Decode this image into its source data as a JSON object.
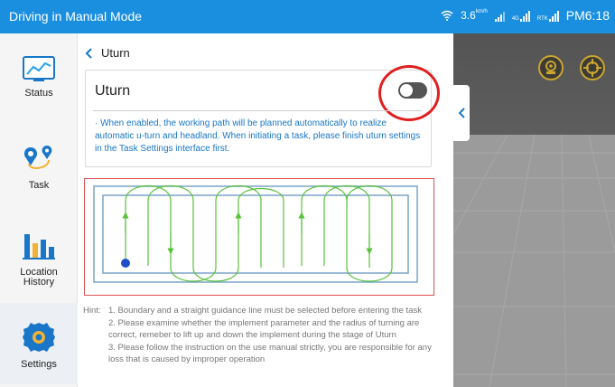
{
  "status_bar": {
    "title": "Driving in Manual Mode",
    "speed_value": "3.6",
    "speed_unit": "km/h",
    "network_label": "4G",
    "rtk_label": "RTK",
    "time": "PM6:18"
  },
  "sidebar": {
    "items": [
      {
        "label": "Status",
        "icon": "status-chart-icon"
      },
      {
        "label": "Task",
        "icon": "route-icon"
      },
      {
        "label": "Location History",
        "icon": "bar-chart-icon"
      },
      {
        "label": "Settings",
        "icon": "gear-icon"
      }
    ],
    "active": "Settings"
  },
  "panel": {
    "back_label": "Uturn",
    "card": {
      "title": "Uturn",
      "toggle_state": "off",
      "description": "· When enabled, the working path will be planned automatically to realize automatic u-turn and headland. When initiating a task, please finish uturn settings in the Task Settings interface first."
    },
    "hint": {
      "label": "Hint:",
      "lines": [
        "1. Boundary and a straight guidance line must be selected before entering the task",
        "2. Please examine whether the implement parameter and the radius of turning are correct, remeber to lift up and down the implement during the stage of Uturn",
        "3. Please follow the instruction on the use manual strictly, you are responsible for any loss that is caused by improper operation"
      ]
    }
  },
  "map": {
    "collapse_icon": "chevron-left-icon",
    "buttons": [
      {
        "icon": "camera-icon"
      },
      {
        "icon": "locate-crosshair-icon"
      }
    ]
  },
  "colors": {
    "accent": "#1a8fe0",
    "description_text": "#1976c8",
    "highlight": "#e02020",
    "path": "#57c23a",
    "boundary": "#7aa3c8"
  }
}
